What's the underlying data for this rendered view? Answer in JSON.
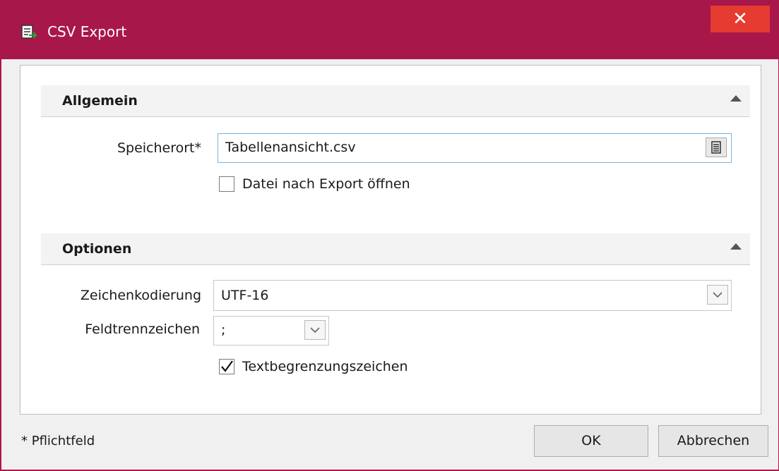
{
  "window": {
    "title": "CSV Export",
    "close_symbol": "✕",
    "icon": "csv-export-icon",
    "accent_color": "#a8174a",
    "close_color": "#e63b30"
  },
  "sections": [
    {
      "title": "Allgemein",
      "fields": {
        "location_label": "Speicherort*",
        "location_value": "Tabellenansicht.csv",
        "open_after_export_label": "Datei nach Export öffnen",
        "open_after_export_checked": false
      }
    },
    {
      "title": "Optionen",
      "fields": {
        "encoding_label": "Zeichenkodierung",
        "encoding_value": "UTF-16",
        "separator_label": "Feldtrennzeichen",
        "separator_value": ";",
        "text_qualifier_label": "Textbegrenzungszeichen",
        "text_qualifier_checked": true
      }
    }
  ],
  "footer": {
    "required_note": "* Pflichtfeld",
    "ok_label": "OK",
    "cancel_label": "Abbrechen"
  }
}
